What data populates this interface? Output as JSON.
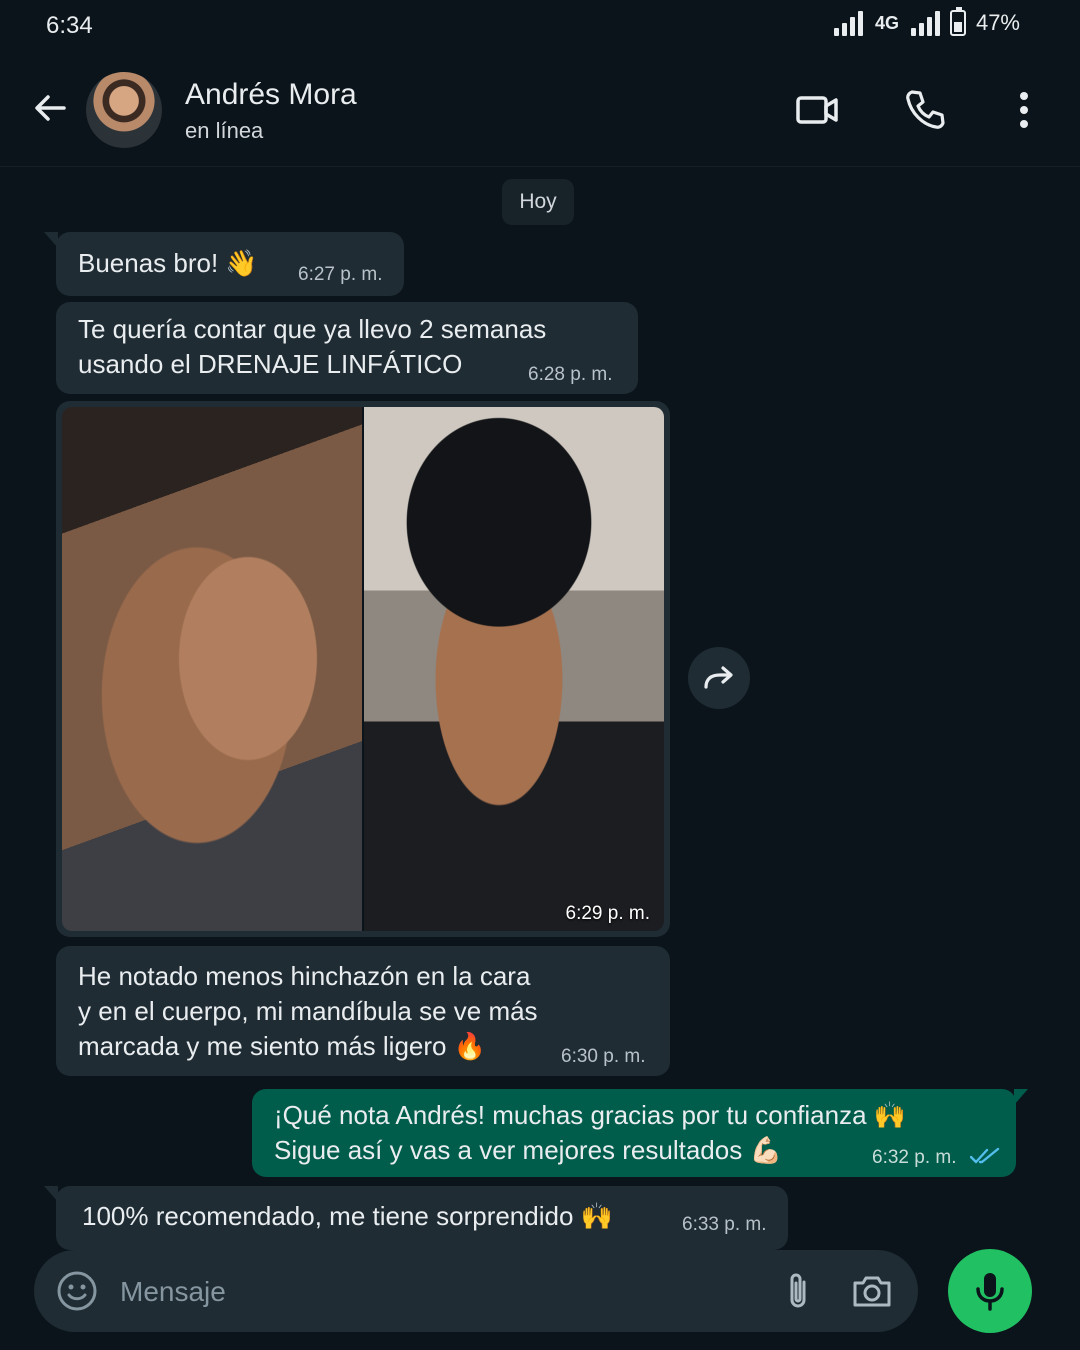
{
  "status_bar": {
    "time": "6:34",
    "network": "4G",
    "battery": "47%",
    "battery_level": 0.47
  },
  "header": {
    "contact_name": "Andrés Mora",
    "contact_status": "en línea",
    "icons": [
      "back-arrow-icon",
      "video-call-icon",
      "phone-icon",
      "more-vert-icon"
    ]
  },
  "chat": {
    "date_chip": "Hoy",
    "messages": [
      {
        "direction": "in",
        "text": "Buenas bro! 👋",
        "time": "6:27 p. m."
      },
      {
        "direction": "in",
        "text": "Te quería contar que ya llevo 2 semanas\nusando el DRENAJE LINFÁTICO",
        "time": "6:28 p. m."
      },
      {
        "direction": "in",
        "type": "image",
        "time": "6:29 p. m."
      },
      {
        "direction": "in",
        "text": "He notado menos hinchazón en la cara\ny en el cuerpo, mi mandíbula se ve más\nmarcada y me siento más ligero 🔥",
        "time": "6:30 p. m."
      },
      {
        "direction": "out",
        "text": "¡Qué nota Andrés! muchas gracias por tu confianza 🙌\nSigue así y vas a ver mejores resultados 💪🏻",
        "time": "6:32 p. m.",
        "status": "read"
      },
      {
        "direction": "in",
        "text": "100% recomendado, me tiene sorprendido 🙌",
        "time": "6:33 p. m."
      }
    ]
  },
  "composer": {
    "placeholder": "Mensaje"
  },
  "colors": {
    "background": "#0b141a",
    "incoming_bubble": "#1f2c34",
    "outgoing_bubble": "#005c4b",
    "mic_button": "#21c063",
    "read_ticks": "#53bdeb"
  }
}
